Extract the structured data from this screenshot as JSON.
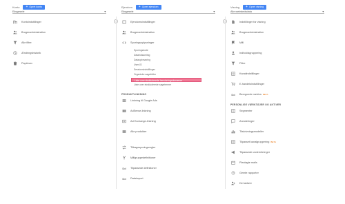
{
  "account": {
    "label": "Konto",
    "create_label": "Opret konto",
    "selected": "Eksgesele",
    "items": [
      {
        "label": "Kontoindstillinger",
        "icon": "building-icon"
      },
      {
        "label": "Brugeradministration",
        "icon": "users-icon"
      },
      {
        "label": "Alle filtre",
        "icon": "filter-icon"
      },
      {
        "label": "Ændringshistorik",
        "icon": "history-icon"
      },
      {
        "label": "Papirkurv",
        "icon": "trash-icon"
      }
    ]
  },
  "property": {
    "label": "Ejendom",
    "create_label": "Opret ejendom",
    "selected": "Eksgesele",
    "items_top": [
      {
        "label": "Ejendomsindstillinger",
        "icon": "square-icon"
      },
      {
        "label": "Brugeradministration",
        "icon": "users-icon"
      },
      {
        "label": "Sporingsoplysninger",
        "icon": "code-icon"
      }
    ],
    "tracking_sub": [
      "Sporingskode",
      "Dataindsamling",
      "Dataopbevaring",
      "User-ID",
      "Sessionsindstillinger",
      "Organiske søgekilder",
      "Liste over ekskluderede henvisningsdomæner",
      "Liste over ekskluderede søgetermer"
    ],
    "section_title": "PRODUKTLINKNING",
    "items_bottom": [
      {
        "label": "Linkning til Google Ads",
        "icon": "grid-icon"
      },
      {
        "label": "AdSense-linkning",
        "icon": "grid-icon"
      },
      {
        "label": "Ad Exchange-linkning",
        "icon": "grid-icon"
      },
      {
        "label": "Alle produkter",
        "icon": "grid-icon"
      },
      {
        "label": "Tilbagesporingsregler",
        "icon": "arrows-icon"
      },
      {
        "label": "Målgruppedefinitioner",
        "icon": "fork-icon"
      },
      {
        "label": "Tilpassede definitioner",
        "icon": "dd-icon"
      },
      {
        "label": "Dataimport",
        "icon": "dd-icon"
      }
    ]
  },
  "view": {
    "label": "Visning",
    "create_label": "Opret visning",
    "selected": "Alle webstedsdata",
    "items": [
      {
        "label": "Indstillinger for visning",
        "icon": "doc-icon"
      },
      {
        "label": "Brugeradministration",
        "icon": "users-icon"
      },
      {
        "label": "Mål",
        "icon": "flag-icon"
      },
      {
        "label": "Indholdsgruppering",
        "icon": "person-icon"
      },
      {
        "label": "Filtre",
        "icon": "filter-icon"
      },
      {
        "label": "Kanalindstillinger",
        "icon": "grid-icon"
      },
      {
        "label": "E-handelsindstillinger",
        "icon": "cart-icon"
      },
      {
        "label": "Beregnede metrics",
        "icon": "dd-icon",
        "beta": "BETA"
      }
    ],
    "section_title": "PERSONLIGE VÆRKTØJER OG AKTIVER",
    "items_personal": [
      {
        "label": "Segmenter",
        "icon": "segment-icon"
      },
      {
        "label": "Annoteringer",
        "icon": "note-icon"
      },
      {
        "label": "Tilskrivningsmodeller",
        "icon": "bars-icon"
      },
      {
        "label": "Tilpasset kanalgruppering",
        "icon": "grid-icon",
        "beta": "BETA"
      },
      {
        "label": "Tilpassede underretninger",
        "icon": "megaphone-icon"
      },
      {
        "label": "Planlagte mails",
        "icon": "calendar-icon"
      },
      {
        "label": "Gemte rapporter",
        "icon": "report-icon"
      },
      {
        "label": "Del aktiver",
        "icon": "share-users-icon"
      }
    ]
  },
  "colors": {
    "button": "#4285f4",
    "highlight": "#f27a96"
  }
}
